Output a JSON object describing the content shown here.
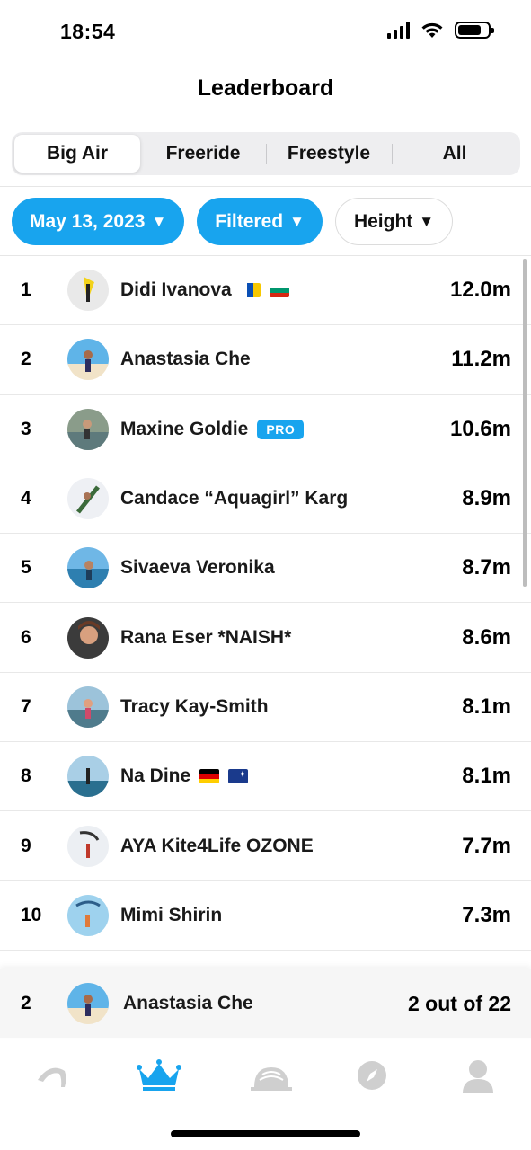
{
  "status_bar": {
    "time": "18:54"
  },
  "header": {
    "title": "Leaderboard"
  },
  "tabs": [
    {
      "label": "Big Air",
      "active": true
    },
    {
      "label": "Freeride",
      "active": false
    },
    {
      "label": "Freestyle",
      "active": false
    },
    {
      "label": "All",
      "active": false
    }
  ],
  "filters": {
    "date": "May 13, 2023",
    "filter": "Filtered",
    "metric": "Height",
    "caret": "▼"
  },
  "leaderboard": [
    {
      "rank": "1",
      "name": "Didi Ivanova",
      "value": "12.0m",
      "flags": [
        "canary-islands",
        "bulgaria"
      ]
    },
    {
      "rank": "2",
      "name": "Anastasia Che",
      "value": "11.2m"
    },
    {
      "rank": "3",
      "name": "Maxine Goldie",
      "value": "10.6m",
      "badge": "PRO"
    },
    {
      "rank": "4",
      "name": "Candace “Aquagirl” Karg",
      "value": "8.9m"
    },
    {
      "rank": "5",
      "name": "Sivaeva Veronika",
      "value": "8.7m"
    },
    {
      "rank": "6",
      "name": "Rana Eser *NAISH*",
      "value": "8.6m"
    },
    {
      "rank": "7",
      "name": "Tracy Kay-Smith",
      "value": "8.1m"
    },
    {
      "rank": "8",
      "name": "Na Dine",
      "value": "8.1m",
      "flags": [
        "germany",
        "australia"
      ]
    },
    {
      "rank": "9",
      "name": "AYA Kite4Life OZONE",
      "value": "7.7m"
    },
    {
      "rank": "10",
      "name": "Mimi Shirin",
      "value": "7.3m"
    }
  ],
  "current_user": {
    "rank": "2",
    "name": "Anastasia Che",
    "position_text": "2 out of 22"
  },
  "tabbar": {
    "items": [
      {
        "icon": "kite-icon",
        "active": false
      },
      {
        "icon": "crown-icon",
        "active": true
      },
      {
        "icon": "dome-icon",
        "active": false
      },
      {
        "icon": "compass-icon",
        "active": false
      },
      {
        "icon": "profile-icon",
        "active": false
      }
    ]
  },
  "colors": {
    "accent": "#18a4ee",
    "inactive_icon": "#cfcfcf"
  }
}
